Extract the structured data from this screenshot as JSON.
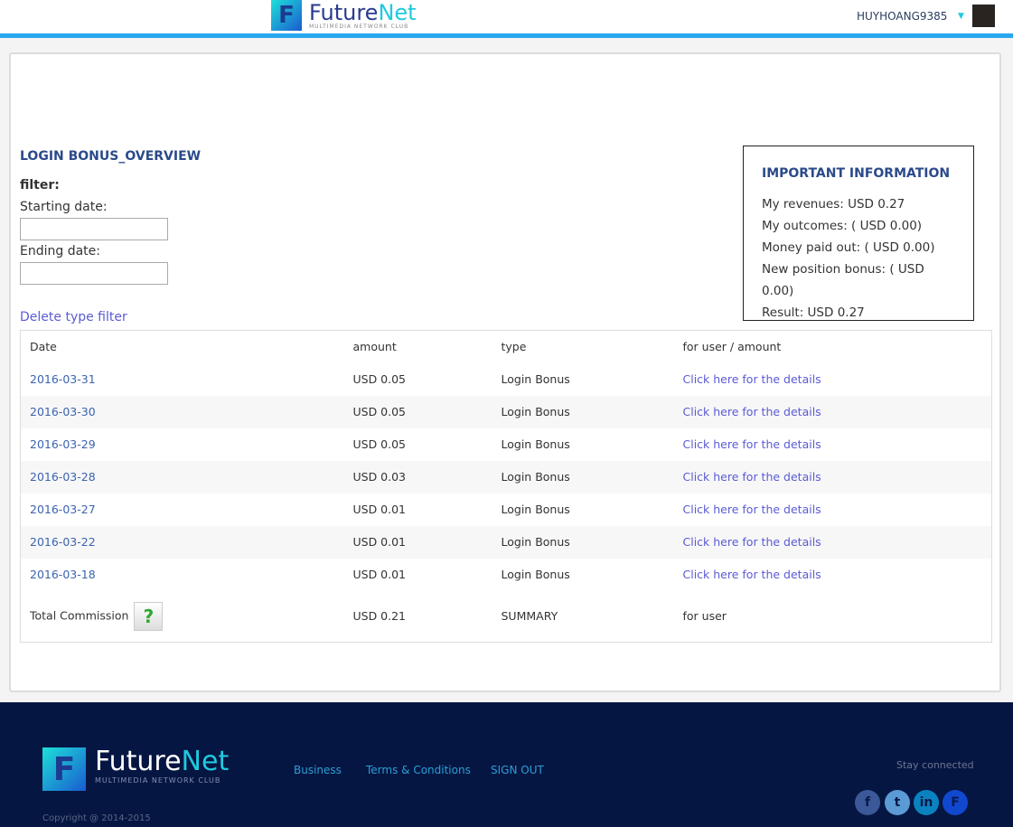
{
  "header": {
    "brand": "Future",
    "brand_accent": "Net",
    "tagline": "MULTIMEDIA NETWORK CLUB",
    "username": "HUYHOANG9385"
  },
  "page": {
    "title": "LOGIN BONUS_OVERVIEW",
    "filter_label": "filter:",
    "start_label": "Starting date:",
    "start_value": "",
    "end_label": "Ending date:",
    "end_value": "",
    "delete_filter": "Delete type filter"
  },
  "info": {
    "title": "IMPORTANT INFORMATION",
    "lines": [
      "My revenues: USD 0.27",
      "My outcomes: ( USD 0.00)",
      "Money paid out: ( USD 0.00)",
      "New position bonus: ( USD 0.00)",
      "Result: USD 0.27"
    ]
  },
  "table": {
    "headers": [
      "Date",
      "amount",
      "type",
      "for user / amount"
    ],
    "rows": [
      {
        "date": "2016-03-31",
        "amount": "USD 0.05",
        "type": "Login Bonus",
        "link": "Click here for the details"
      },
      {
        "date": "2016-03-30",
        "amount": "USD 0.05",
        "type": "Login Bonus",
        "link": "Click here for the details"
      },
      {
        "date": "2016-03-29",
        "amount": "USD 0.05",
        "type": "Login Bonus",
        "link": "Click here for the details"
      },
      {
        "date": "2016-03-28",
        "amount": "USD 0.03",
        "type": "Login Bonus",
        "link": "Click here for the details"
      },
      {
        "date": "2016-03-27",
        "amount": "USD 0.01",
        "type": "Login Bonus",
        "link": "Click here for the details"
      },
      {
        "date": "2016-03-22",
        "amount": "USD 0.01",
        "type": "Login Bonus",
        "link": "Click here for the details"
      },
      {
        "date": "2016-03-18",
        "amount": "USD 0.01",
        "type": "Login Bonus",
        "link": "Click here for the details"
      }
    ],
    "total": {
      "label": "Total Commission",
      "help": "?",
      "amount": "USD 0.21",
      "type": "SUMMARY",
      "user": "for user"
    }
  },
  "footer": {
    "links": [
      "Business",
      "Terms & Conditions",
      "SIGN OUT"
    ],
    "stay": "Stay connected",
    "copyright": "Copyright @ 2014-2015",
    "social": [
      "facebook",
      "twitter",
      "linkedin",
      "futurenet"
    ]
  }
}
